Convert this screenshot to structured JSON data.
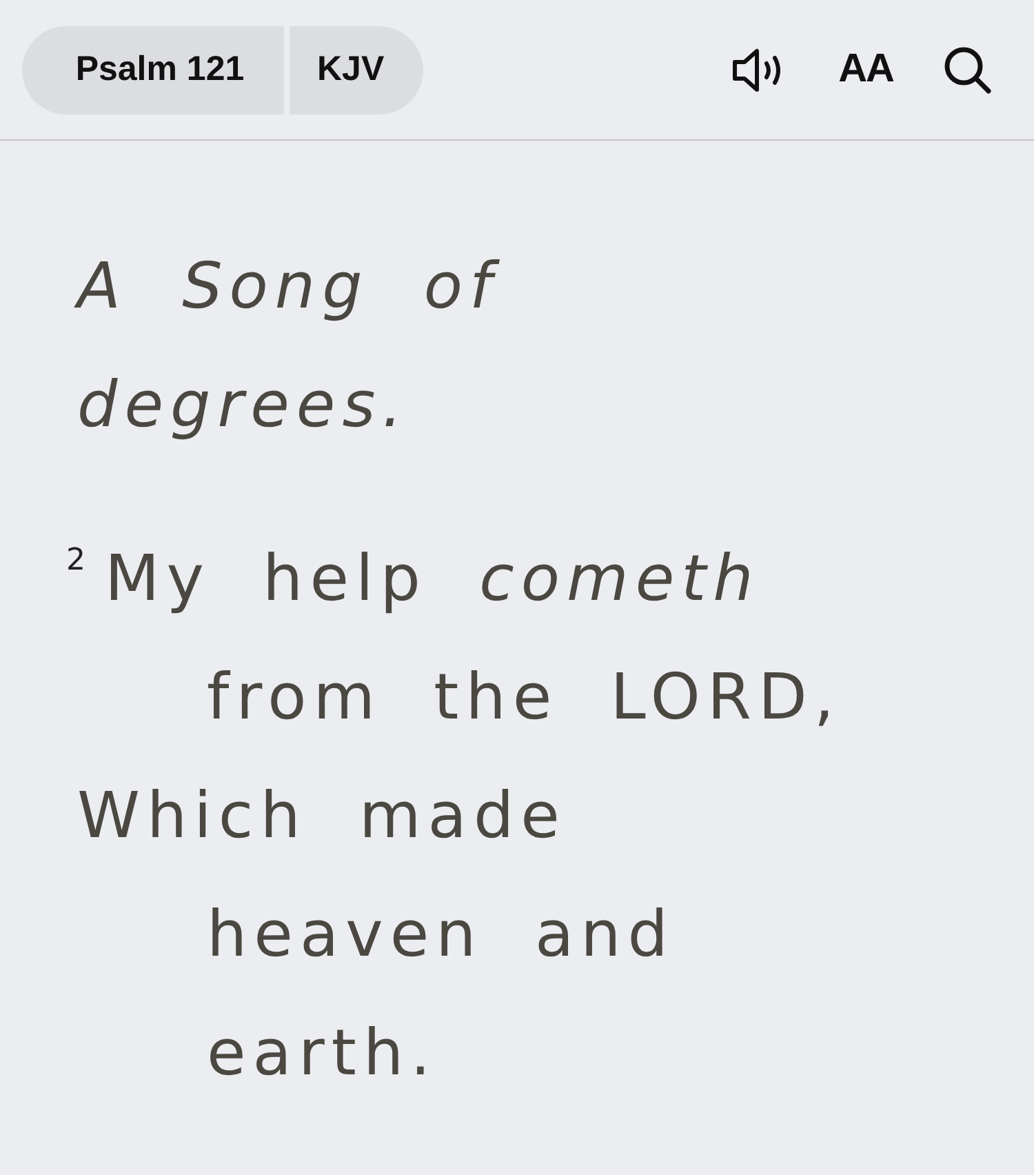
{
  "header": {
    "book_button": "Psalm 121",
    "version_button": "KJV",
    "font_button": "AA"
  },
  "superscription": "A Song of degrees.",
  "verses": [
    {
      "number": "2",
      "lines": [
        {
          "kind": "first",
          "text": "My help *cometh*"
        },
        {
          "kind": "wrap",
          "text": "from the LORD,"
        },
        {
          "kind": "first",
          "text": "Which made"
        },
        {
          "kind": "wrap",
          "text": "heaven and"
        },
        {
          "kind": "wrap",
          "text": "earth."
        }
      ]
    }
  ]
}
